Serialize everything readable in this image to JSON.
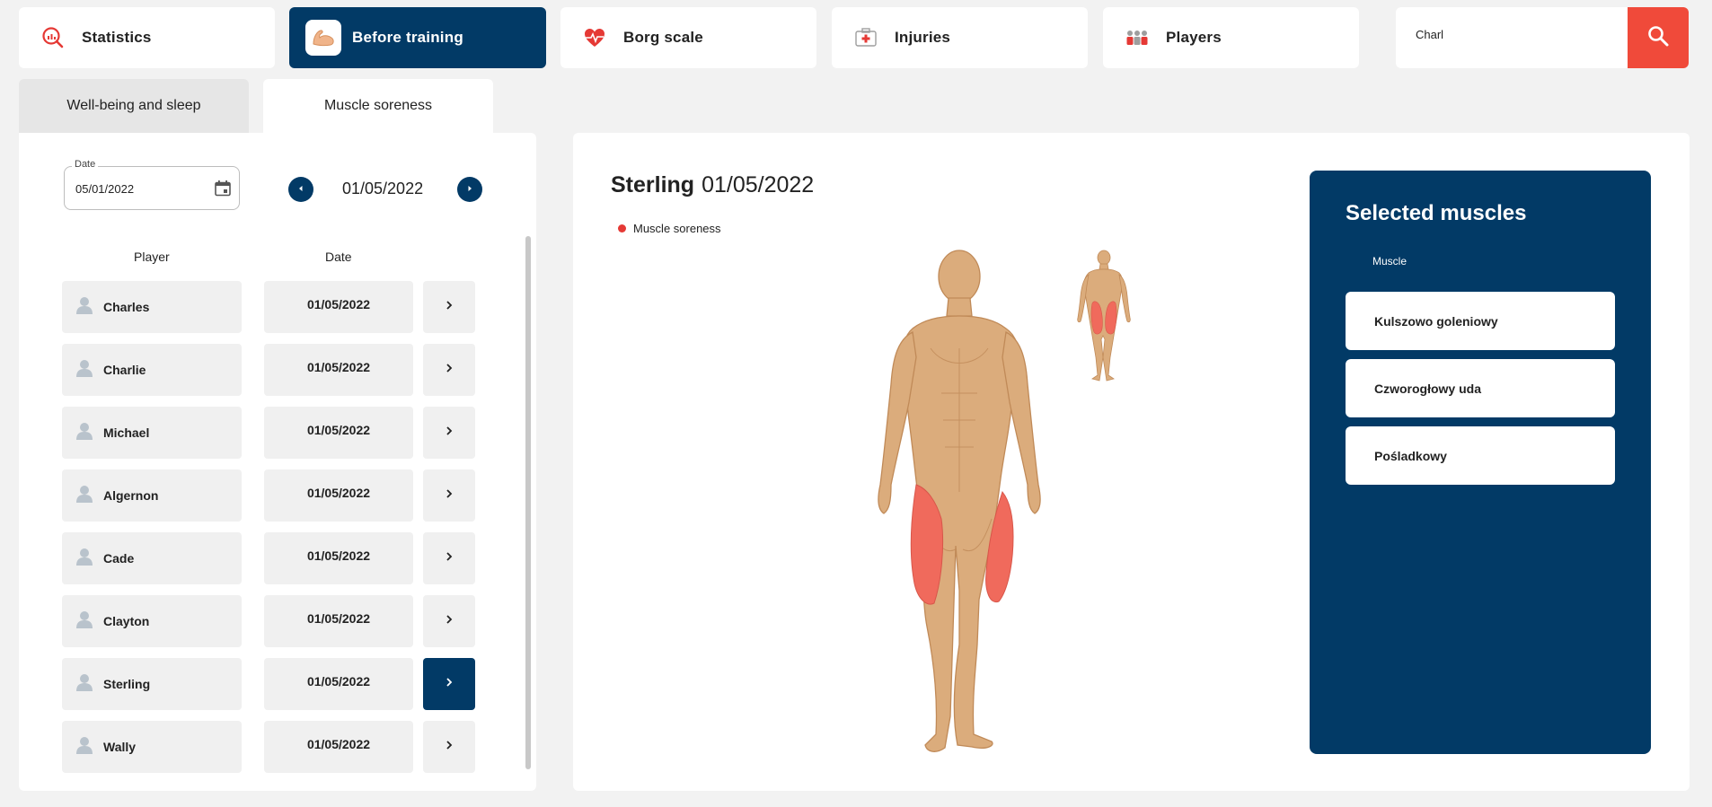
{
  "nav": {
    "items": [
      {
        "label": "Statistics",
        "icon": "chart-magnifier-icon"
      },
      {
        "label": "Before training",
        "icon": "arm-muscle-icon"
      },
      {
        "label": "Borg scale",
        "icon": "heart-pulse-icon"
      },
      {
        "label": "Injuries",
        "icon": "first-aid-kit-icon"
      },
      {
        "label": "Players",
        "icon": "team-icon"
      }
    ],
    "active": "Before training"
  },
  "search": {
    "value": "Charl",
    "icon": "search-icon"
  },
  "tabs": [
    {
      "label": "Well-being and sleep"
    },
    {
      "label": "Muscle soreness"
    }
  ],
  "date_filter": {
    "label": "Date",
    "value": "05/01/2022",
    "current_date": "01/05/2022"
  },
  "table": {
    "headers": {
      "player": "Player",
      "date": "Date"
    },
    "rows": [
      {
        "player": "Charles",
        "date": "01/05/2022"
      },
      {
        "player": "Charlie",
        "date": "01/05/2022"
      },
      {
        "player": "Michael",
        "date": "01/05/2022"
      },
      {
        "player": "Algernon",
        "date": "01/05/2022"
      },
      {
        "player": "Cade",
        "date": "01/05/2022"
      },
      {
        "player": "Clayton",
        "date": "01/05/2022"
      },
      {
        "player": "Sterling",
        "date": "01/05/2022"
      },
      {
        "player": "Wally",
        "date": "01/05/2022"
      }
    ],
    "selected_player": "Sterling"
  },
  "detail": {
    "player": "Sterling",
    "date": "01/05/2022",
    "legend_label": "Muscle soreness",
    "legend_color": "#e53935"
  },
  "selected_muscles": {
    "title": "Selected muscles",
    "column": "Muscle",
    "items": [
      "Kulszowo goleniowy",
      "Czworogłowy uda",
      "Pośladkowy"
    ]
  },
  "colors": {
    "primary": "#023a66",
    "accent": "#f04a3a",
    "skin": "#dbac7c",
    "highlight": "#f06a5c"
  }
}
